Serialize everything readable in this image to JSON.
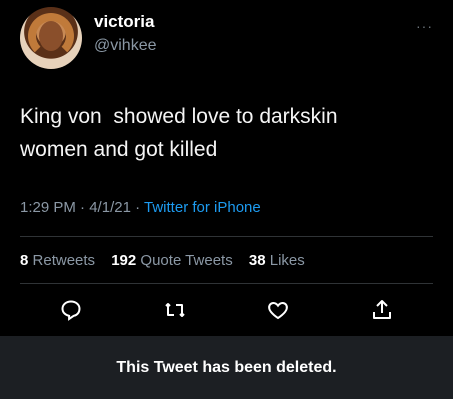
{
  "user": {
    "name": "victoria",
    "handle": "@vihkee"
  },
  "tweet": {
    "text": "King von  showed love to darkskin\nwomen and got killed",
    "time": "1:29 PM",
    "sep1": "·",
    "date": "4/1/21",
    "sep2": "·",
    "source": "Twitter for iPhone"
  },
  "stats": {
    "retweets_count": "8",
    "retweets_label": "Retweets",
    "quotes_count": "192",
    "quotes_label": "Quote Tweets",
    "likes_count": "38",
    "likes_label": "Likes"
  },
  "menu": {
    "more": "···"
  },
  "icons": {
    "reply": "reply-icon",
    "retweet": "retweet-icon",
    "like": "heart-icon",
    "share": "share-icon"
  },
  "colors": {
    "background": "#000000",
    "link": "#1d9bf0",
    "muted": "#8b98a5",
    "banner": "#1c1f23"
  },
  "banner": {
    "message": "This Tweet has been deleted."
  }
}
